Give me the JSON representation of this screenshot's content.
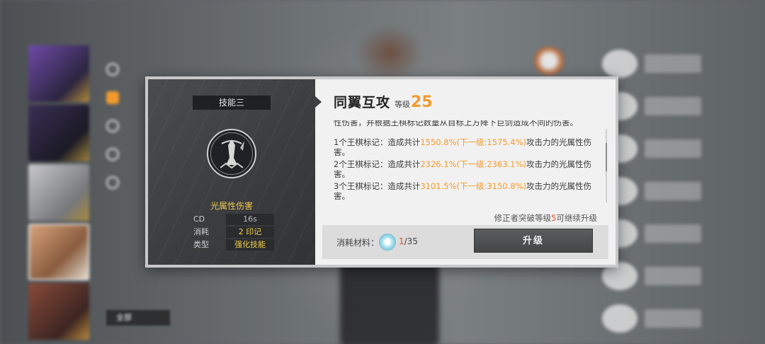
{
  "background": {
    "filter_label": "全部"
  },
  "dialog": {
    "left": {
      "skill_slot": "技能三",
      "skill_icon": "crystal-guardian-icon",
      "damage_type": "光属性伤害",
      "stats": [
        {
          "key": "CD",
          "value": "16s",
          "highlight": false
        },
        {
          "key": "消耗",
          "value": "2 印记",
          "highlight": true
        },
        {
          "key": "类型",
          "value": "强化技能",
          "highlight": true
        }
      ]
    },
    "right": {
      "skill_name": "同翼互攻",
      "level_label": "等级",
      "level_value": "25",
      "desc_cut": "性伤害，并根据王棋标记数量从目标上方降下巨剑造成不同的伤害。",
      "tiers": [
        {
          "pre": "1个王棋标记：造成共计",
          "hl": "1550.8%(下一级:1575.4%)",
          "post": "攻击力的光属性伤害。"
        },
        {
          "pre": "2个王棋标记：造成共计",
          "hl": "2326.1%(下一级:2363.1%)",
          "post": "攻击力的光属性伤害。"
        },
        {
          "pre": "3个王棋标记：造成共计",
          "hl": "3101.5%(下一级:3150.8%)",
          "post": "攻击力的光属性伤害。"
        }
      ],
      "upgrade_note_pre": "修正者突破等级",
      "upgrade_note_level": "5",
      "upgrade_note_post": "可继续升级",
      "material_label": "消耗材料：",
      "material_icon": "skill-crystal-icon",
      "material_current": "1",
      "material_required": "/35",
      "upgrade_button": "升级"
    }
  },
  "colors": {
    "accent": "#f29b2c",
    "highlight_red": "#e24b2c",
    "stat_yellow": "#f2d24b"
  }
}
